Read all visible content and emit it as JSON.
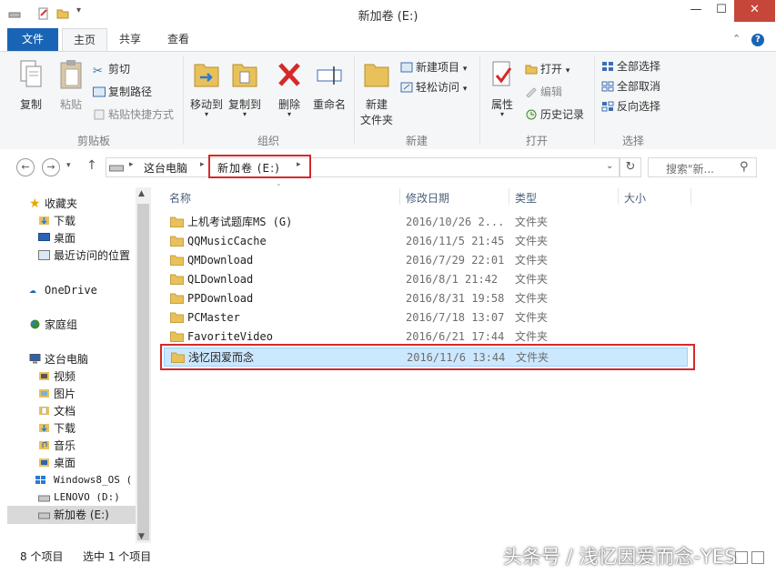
{
  "window": {
    "title": "新加卷 (E:)"
  },
  "tabs": {
    "file": "文件",
    "home": "主页",
    "share": "共享",
    "view": "查看"
  },
  "ribbon": {
    "clipboard": {
      "label": "剪贴板",
      "copy": "复制",
      "paste": "粘贴",
      "cut": "剪切",
      "copy_path": "复制路径",
      "paste_shortcut": "粘贴快捷方式"
    },
    "organize": {
      "label": "组织",
      "move_to": "移动到",
      "copy_to": "复制到",
      "delete": "删除",
      "rename": "重命名"
    },
    "new": {
      "label": "新建",
      "new_folder_1": "新建",
      "new_folder_2": "文件夹",
      "new_item": "新建项目",
      "easy_access": "轻松访问"
    },
    "open": {
      "label": "打开",
      "properties": "属性",
      "open": "打开",
      "edit": "编辑",
      "history": "历史记录"
    },
    "select": {
      "label": "选择",
      "select_all": "全部选择",
      "select_none": "全部取消",
      "invert": "反向选择"
    }
  },
  "address": {
    "crumb_1": "这台电脑",
    "crumb_2": "新加卷 (E:)",
    "search_placeholder": "搜索\"新..."
  },
  "nav": {
    "favorites": "收藏夹",
    "downloads": "下载",
    "desktop": "桌面",
    "recent": "最近访问的位置",
    "onedrive": "OneDrive",
    "homegroup": "家庭组",
    "this_pc": "这台电脑",
    "videos": "视频",
    "pictures": "图片",
    "documents": "文档",
    "downloads2": "下载",
    "music": "音乐",
    "desktop2": "桌面",
    "drive_c": "Windows8_OS (",
    "drive_d": "LENOVO (D:)",
    "drive_e": "新加卷 (E:)"
  },
  "columns": {
    "name": "名称",
    "date": "修改日期",
    "type": "类型",
    "size": "大小"
  },
  "files": [
    {
      "name": "上机考试题库MS (G)",
      "date": "2016/10/26 2...",
      "type": "文件夹"
    },
    {
      "name": "QQMusicCache",
      "date": "2016/11/5 21:45",
      "type": "文件夹"
    },
    {
      "name": "QMDownload",
      "date": "2016/7/29 22:01",
      "type": "文件夹"
    },
    {
      "name": "QLDownload",
      "date": "2016/8/1 21:42",
      "type": "文件夹"
    },
    {
      "name": "PPDownload",
      "date": "2016/8/31 19:58",
      "type": "文件夹"
    },
    {
      "name": "PCMaster",
      "date": "2016/7/18 13:07",
      "type": "文件夹"
    },
    {
      "name": "FavoriteVideo",
      "date": "2016/6/21 17:44",
      "type": "文件夹"
    },
    {
      "name": "浅忆因爱而念",
      "date": "2016/11/6 13:44",
      "type": "文件夹"
    }
  ],
  "status": {
    "count": "8 个项目",
    "selected": "选中 1 个项目"
  },
  "watermark": "头条号 / 浅忆因爱而念-YES",
  "colors": {
    "accent": "#1a64b5",
    "highlight": "#d42a2a",
    "selection": "#cce8ff",
    "folder": "#e8c15a"
  }
}
